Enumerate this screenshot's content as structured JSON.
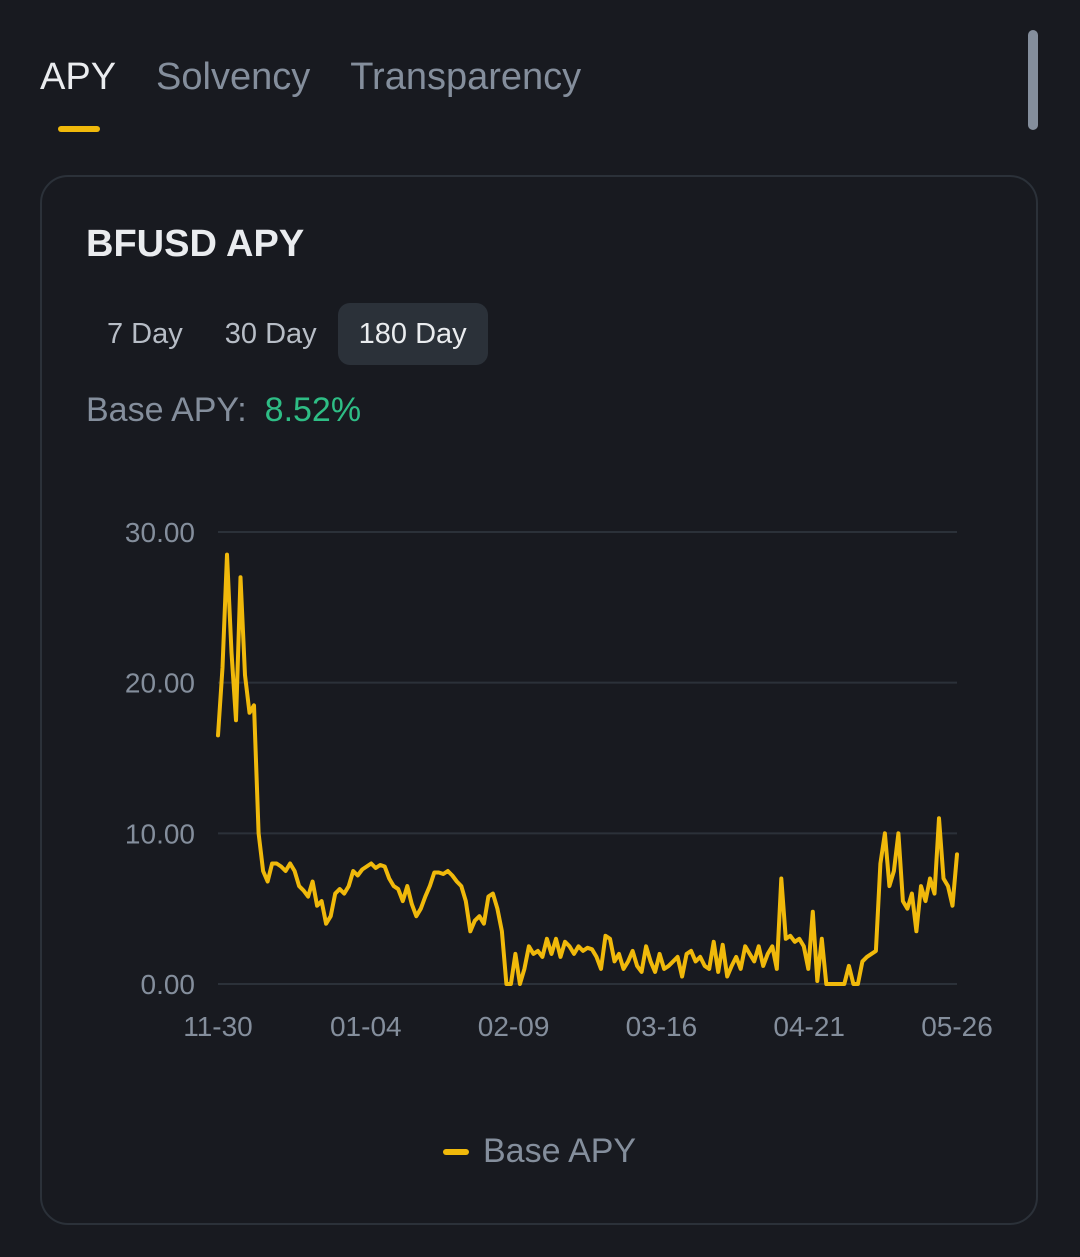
{
  "tabs": [
    {
      "label": "APY",
      "active": true
    },
    {
      "label": "Solvency",
      "active": false
    },
    {
      "label": "Transparency",
      "active": false
    }
  ],
  "card": {
    "title": "BFUSD APY",
    "periods": [
      {
        "label": "7 Day",
        "active": false
      },
      {
        "label": "30 Day",
        "active": false
      },
      {
        "label": "180 Day",
        "active": true
      }
    ],
    "base_apy_label": "Base APY:",
    "base_apy_value": "8.52%"
  },
  "colors": {
    "accent": "#f0b90b",
    "positive": "#2ebd85",
    "background": "#181a20"
  },
  "chart_data": {
    "type": "line",
    "title": "",
    "xlabel": "",
    "ylabel": "",
    "ylim": [
      0,
      30
    ],
    "y_ticks": [
      "30.00",
      "20.00",
      "10.00",
      "0.00"
    ],
    "y_tick_values": [
      30,
      20,
      10,
      0
    ],
    "x_ticks": [
      "11-30",
      "01-04",
      "02-09",
      "03-16",
      "04-21",
      "05-26"
    ],
    "grid": true,
    "legend": "bottom-center",
    "series": [
      {
        "name": "Base APY",
        "color": "#f0b90b",
        "values": [
          16.5,
          21.0,
          28.5,
          22.0,
          17.5,
          27.0,
          20.5,
          18.0,
          18.5,
          10.0,
          7.5,
          6.8,
          8.0,
          8.0,
          7.8,
          7.5,
          8.0,
          7.5,
          6.5,
          6.2,
          5.8,
          6.8,
          5.2,
          5.5,
          4.0,
          4.5,
          6.0,
          6.3,
          6.0,
          6.5,
          7.5,
          7.2,
          7.6,
          7.8,
          8.0,
          7.7,
          7.9,
          7.8,
          7.0,
          6.5,
          6.3,
          5.5,
          6.5,
          5.3,
          4.5,
          5.0,
          5.8,
          6.5,
          7.4,
          7.4,
          7.3,
          7.5,
          7.2,
          6.8,
          6.5,
          5.5,
          3.5,
          4.2,
          4.5,
          4.0,
          5.8,
          6.0,
          5.0,
          3.5,
          0.0,
          0.0,
          2.0,
          0.0,
          1.0,
          2.5,
          2.0,
          2.2,
          1.8,
          3.0,
          2.0,
          3.0,
          1.8,
          2.8,
          2.5,
          2.0,
          2.5,
          2.2,
          2.4,
          2.3,
          1.8,
          1.0,
          3.2,
          3.0,
          1.5,
          2.0,
          1.0,
          1.5,
          2.2,
          1.2,
          0.8,
          2.5,
          1.5,
          0.8,
          2.0,
          1.0,
          1.2,
          1.5,
          1.8,
          0.5,
          2.0,
          2.2,
          1.5,
          1.8,
          1.2,
          1.0,
          2.8,
          0.8,
          2.6,
          0.5,
          1.2,
          1.8,
          1.0,
          2.5,
          2.0,
          1.5,
          2.5,
          1.2,
          2.0,
          2.5,
          1.0,
          7.0,
          3.0,
          3.2,
          2.8,
          3.0,
          2.5,
          1.0,
          4.8,
          0.2,
          3.0,
          0.0,
          0.0,
          0.0,
          0.0,
          0.0,
          1.2,
          0.0,
          0.0,
          1.5,
          1.8,
          2.0,
          2.2,
          8.0,
          10.0,
          6.5,
          7.5,
          10.0,
          5.5,
          5.0,
          6.0,
          3.5,
          6.5,
          5.5,
          7.0,
          6.0,
          11.0,
          7.0,
          6.5,
          5.2,
          8.6
        ]
      }
    ]
  }
}
